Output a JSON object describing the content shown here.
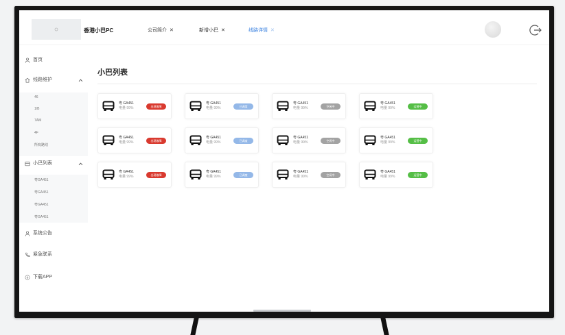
{
  "app": {
    "title": "香港小巴PC"
  },
  "tabs": [
    {
      "label": "公司简介",
      "close": "✕",
      "active": false
    },
    {
      "label": "新增小巴",
      "close": "✕",
      "active": false
    },
    {
      "label": "线路详情",
      "close": "✕",
      "active": true
    }
  ],
  "sidebar": {
    "home": "首页",
    "route_maintenance": {
      "label": "线路维护",
      "items": [
        "46",
        "1/B",
        "7AM",
        "4F",
        "所有路线"
      ]
    },
    "bus_list": {
      "label": "小巴列表",
      "items": [
        "粤GA451",
        "粤GA451",
        "粤GA451",
        "粤GA451"
      ]
    },
    "announcements": "系统公告",
    "emergency": "紧急联系",
    "download": "下载APP"
  },
  "main": {
    "title": "小巴列表",
    "cards": [
      {
        "plate": "粤 GA451",
        "battery": "电量 99%",
        "status": "出现故障",
        "status_color": "#d93a2f"
      },
      {
        "plate": "粤 GA451",
        "battery": "电量 99%",
        "status": "已调度",
        "status_color": "#94b8e8"
      },
      {
        "plate": "粤 GA451",
        "battery": "电量 99%",
        "status": "空闲中",
        "status_color": "#a3a3a3"
      },
      {
        "plate": "粤 GA451",
        "battery": "电量 99%",
        "status": "运营中",
        "status_color": "#55be46"
      },
      {
        "plate": "粤 GA451",
        "battery": "电量 99%",
        "status": "出现故障",
        "status_color": "#d93a2f"
      },
      {
        "plate": "粤 GA451",
        "battery": "电量 99%",
        "status": "已调度",
        "status_color": "#94b8e8"
      },
      {
        "plate": "粤 GA451",
        "battery": "电量 99%",
        "status": "空闲中",
        "status_color": "#a3a3a3"
      },
      {
        "plate": "粤 GA451",
        "battery": "电量 99%",
        "status": "运营中",
        "status_color": "#55be46"
      },
      {
        "plate": "粤 GA451",
        "battery": "电量 99%",
        "status": "出现故障",
        "status_color": "#d93a2f"
      },
      {
        "plate": "粤 GA451",
        "battery": "电量 99%",
        "status": "已调度",
        "status_color": "#94b8e8"
      },
      {
        "plate": "粤 GA451",
        "battery": "电量 99%",
        "status": "空闲中",
        "status_color": "#a3a3a3"
      },
      {
        "plate": "粤 GA451",
        "battery": "电量 99%",
        "status": "运营中",
        "status_color": "#55be46"
      }
    ]
  },
  "colors": {
    "accent": "#3b82e0",
    "bezel": "#151515"
  },
  "icons": [
    "logo-icon",
    "avatar",
    "logout-icon",
    "user-icon",
    "home-icon",
    "chevron-up-icon",
    "list-icon",
    "phone-icon",
    "download-icon",
    "bus-icon"
  ]
}
